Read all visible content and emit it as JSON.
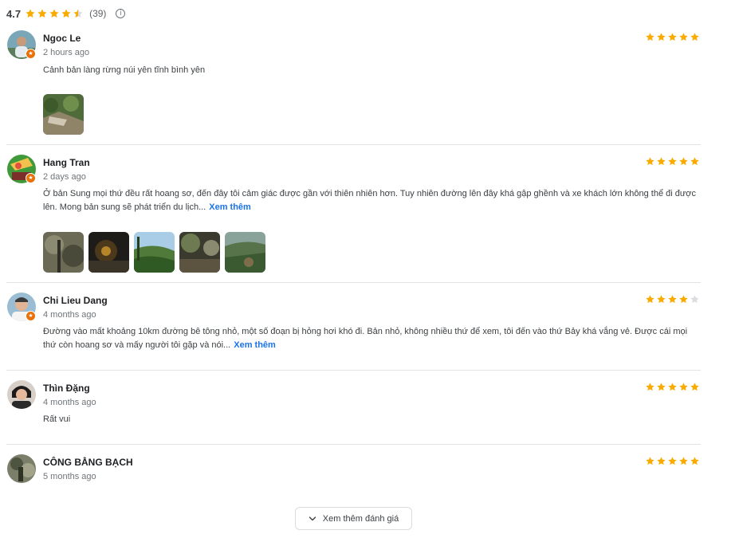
{
  "summary": {
    "rating": "4.7",
    "rating_value": 4.7,
    "count": "(39)",
    "star_color": "#f9ab00",
    "star_empty_color": "#dadce0"
  },
  "reviews": [
    {
      "name": "Ngoc Le",
      "time": "2 hours ago",
      "rating": 5,
      "text": "Cảnh bản làng rừng núi yên tĩnh bình yên",
      "more": "",
      "photos": 1
    },
    {
      "name": "Hang Tran",
      "time": "2 days ago",
      "rating": 5,
      "text": "Ở bản Sung mọi thứ đều rất hoang sơ, đến đây tôi cảm giác được gần với thiên nhiên hơn. Tuy nhiên đường lên đây khá gập ghềnh và xe khách lớn không thể đi được lên. Mong bản sung sẽ phát triển du lịch...",
      "more": "Xem thêm",
      "photos": 5
    },
    {
      "name": "Chi Lieu Dang",
      "time": "4 months ago",
      "rating": 4,
      "text": "Đường vào mất khoảng 10km đường bê tông nhỏ, một số đoạn bị hỏng hơi khó đi. Bản nhỏ, không nhiều thứ để xem, tôi đến vào thứ Bảy khá vắng vẻ. Được cái mọi thứ còn hoang sơ và mấy người tôi gặp và nói...",
      "more": "Xem thêm",
      "photos": 0
    },
    {
      "name": "Thìn Đặng",
      "time": "4 months ago",
      "rating": 5,
      "text": "Rất vui",
      "more": "",
      "photos": 0
    },
    {
      "name": "CÔNG BẰNG BẠCH",
      "time": "5 months ago",
      "rating": 5,
      "text": "",
      "more": "",
      "photos": 0
    }
  ],
  "load_more_label": "Xem thêm đánh giá",
  "icons": {
    "star": "star-icon",
    "info": "info-icon",
    "badge": "local-guide-badge-icon",
    "chevron": "chevron-down-icon"
  }
}
